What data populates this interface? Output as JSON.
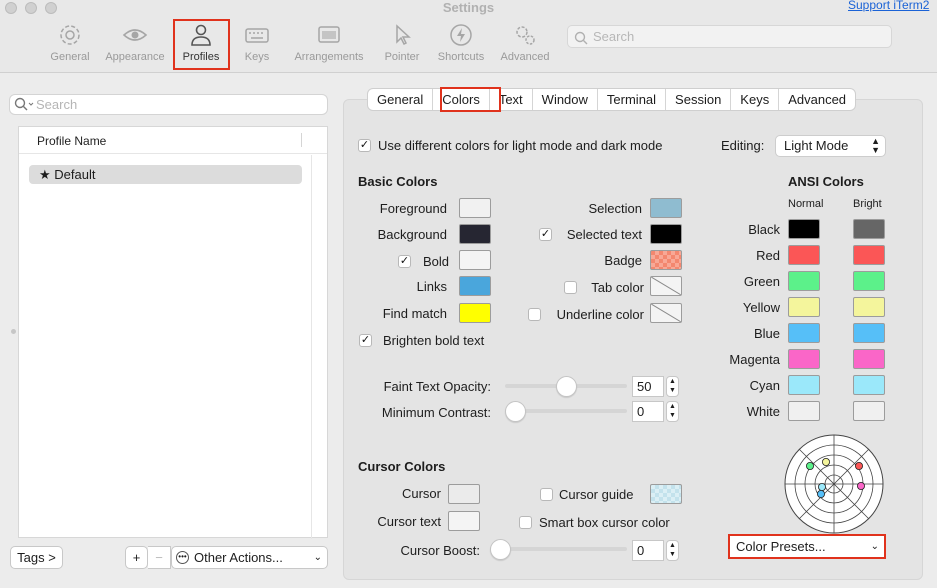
{
  "window": {
    "title": "Settings",
    "support_link": "Support iTerm2"
  },
  "toolbar": {
    "items": [
      {
        "label": "General",
        "icon": "gear-icon"
      },
      {
        "label": "Appearance",
        "icon": "eye-icon"
      },
      {
        "label": "Profiles",
        "icon": "person-icon",
        "active": true
      },
      {
        "label": "Keys",
        "icon": "keyboard-icon"
      },
      {
        "label": "Arrangements",
        "icon": "window-icon"
      },
      {
        "label": "Pointer",
        "icon": "pointer-icon"
      },
      {
        "label": "Shortcuts",
        "icon": "bolt-icon"
      },
      {
        "label": "Advanced",
        "icon": "gears-icon"
      }
    ],
    "search_placeholder": "Search"
  },
  "sidebar": {
    "search_placeholder": "Search",
    "column_header": "Profile Name",
    "profiles": [
      {
        "name": "Default",
        "star": "★"
      }
    ],
    "tags_button": "Tags >",
    "add_button": "+",
    "remove_button": "−",
    "other_actions": "Other Actions..."
  },
  "tabs": [
    "General",
    "Colors",
    "Text",
    "Window",
    "Terminal",
    "Session",
    "Keys",
    "Advanced"
  ],
  "active_tab": "Colors",
  "colors_pane": {
    "use_different_colors_label": "Use different colors for light mode and dark mode",
    "editing_label": "Editing:",
    "editing_value": "Light Mode",
    "basic_colors_title": "Basic Colors",
    "foreground_label": "Foreground",
    "background_label": "Background",
    "bold_label": "Bold",
    "links_label": "Links",
    "find_match_label": "Find match",
    "selection_label": "Selection",
    "selected_text_label": "Selected text",
    "badge_label": "Badge",
    "tab_color_label": "Tab color",
    "underline_color_label": "Underline color",
    "brighten_bold_label": "Brighten bold text",
    "faint_opacity_label": "Faint Text Opacity:",
    "faint_opacity_value": "50",
    "faint_opacity_level": 0.5,
    "min_contrast_label": "Minimum Contrast:",
    "min_contrast_value": "0",
    "min_contrast_level": 0,
    "cursor_colors_title": "Cursor Colors",
    "cursor_label": "Cursor",
    "cursor_text_label": "Cursor text",
    "cursor_guide_label": "Cursor guide",
    "smart_box_label": "Smart box cursor color",
    "cursor_boost_label": "Cursor Boost:",
    "cursor_boost_value": "0",
    "cursor_boost_level": 0,
    "ansi_title": "ANSI Colors",
    "normal_label": "Normal",
    "bright_label": "Bright",
    "color_presets": "Color Presets..."
  },
  "basic_swatches": {
    "foreground": "#f1f1f1",
    "background": "#262632",
    "bold": "#f4f4f4",
    "links": "#4aa6dc",
    "find_match": "#ffff00",
    "selection": "#8fbcd0",
    "selected_text": "#000000",
    "cursor": "#ebebeb",
    "cursor_text": "#f4f4f4"
  },
  "ansi_colors": [
    {
      "name": "Black",
      "normal": "#000000",
      "bright": "#666666"
    },
    {
      "name": "Red",
      "normal": "#fb5656",
      "bright": "#fb5656"
    },
    {
      "name": "Green",
      "normal": "#5cf18a",
      "bright": "#5cf18a"
    },
    {
      "name": "Yellow",
      "normal": "#f4f59c",
      "bright": "#f4f59c"
    },
    {
      "name": "Blue",
      "normal": "#56bff8",
      "bright": "#56bff8"
    },
    {
      "name": "Magenta",
      "normal": "#fa66c8",
      "bright": "#fa66c8"
    },
    {
      "name": "Cyan",
      "normal": "#9be8fa",
      "bright": "#9be8fa"
    },
    {
      "name": "White",
      "normal": "#f0f0f0",
      "bright": "#f0f0f0"
    }
  ],
  "accent_highlight": "#e0321c"
}
